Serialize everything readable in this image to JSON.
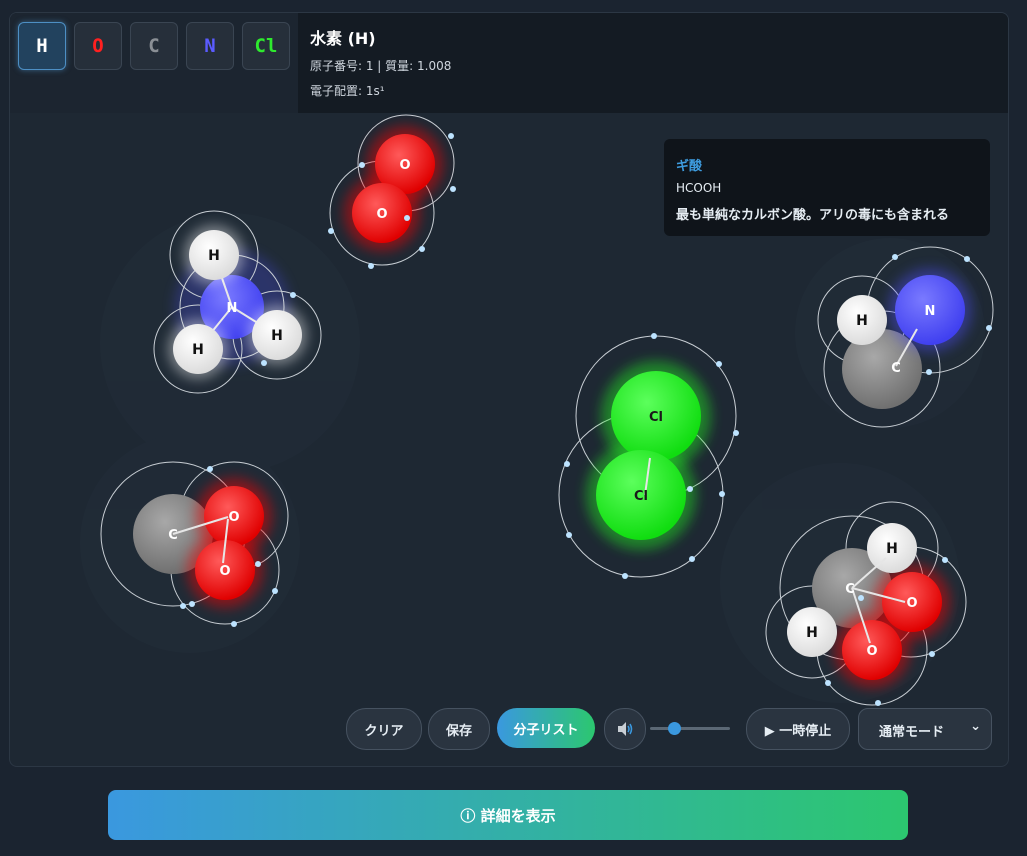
{
  "elements": [
    {
      "symbol": "H",
      "color": "#ffffff",
      "selected": true
    },
    {
      "symbol": "O",
      "color": "#ff2020"
    },
    {
      "symbol": "C",
      "color": "#8a8f95"
    },
    {
      "symbol": "N",
      "color": "#5b5bff"
    },
    {
      "symbol": "Cl",
      "color": "#2eea2e"
    }
  ],
  "info": {
    "title": "水素 (H)",
    "line1": "原子番号: 1 | 質量: 1.008",
    "line2": "電子配置: 1s¹"
  },
  "tooltip": {
    "title": "ギ酸",
    "formula": "HCOOH",
    "description": "最も単純なカルボン酸。アリの毒にも含まれる"
  },
  "controls": {
    "clear": "クリア",
    "save": "保存",
    "molecule_list": "分子リスト",
    "sound_icon": "speaker-icon",
    "volume_fraction": 0.3,
    "pause": "▶ 一時停止",
    "mode": "通常モード",
    "mode_chevron": "⌄"
  },
  "details_button": "ⓘ 詳細を表示",
  "atom_colors": {
    "H": "#ffffff",
    "O": "#ff0000",
    "C": "#808080",
    "N": "#5050ff",
    "Cl": "#22ee22"
  }
}
